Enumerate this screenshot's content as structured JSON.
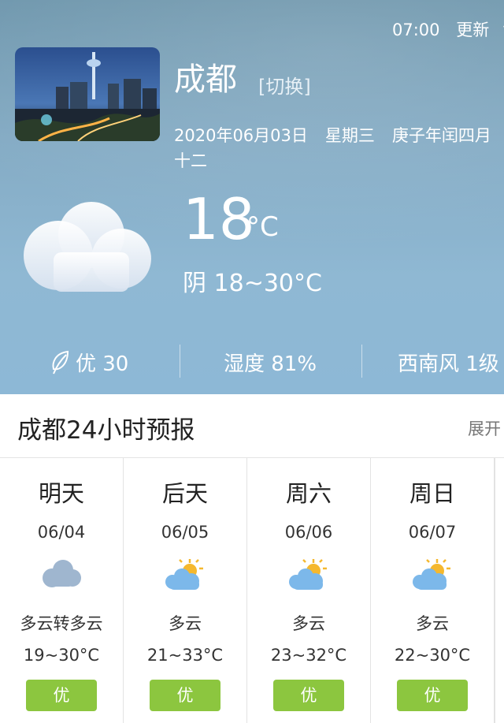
{
  "status": {
    "time": "07:00",
    "refresh_label": "更新",
    "refresh_icon": "refresh-icon"
  },
  "location": {
    "city": "成都",
    "switch_label": "[切换]"
  },
  "date": {
    "date_text": "2020年06月03日",
    "weekday": "星期三",
    "lunar": "庚子年闰四月十二"
  },
  "current": {
    "temperature": "18",
    "unit": "°C",
    "condition": "阴 18~30°C",
    "icon": "cloudy-icon"
  },
  "metrics": {
    "air_quality": "优 30",
    "humidity": "湿度 81%",
    "wind": "西南风 1级"
  },
  "forecast": {
    "title": "成都24小时预报",
    "expand_label": "展开",
    "days": [
      {
        "day": "明天",
        "date": "06/04",
        "condition": "多云转多云",
        "temp": "19~30°C",
        "aqi": "优",
        "icon": "cloud-icon"
      },
      {
        "day": "后天",
        "date": "06/05",
        "condition": "多云",
        "temp": "21~33°C",
        "aqi": "优",
        "icon": "partly-cloudy-icon"
      },
      {
        "day": "周六",
        "date": "06/06",
        "condition": "多云",
        "temp": "23~32°C",
        "aqi": "优",
        "icon": "partly-cloudy-icon"
      },
      {
        "day": "周日",
        "date": "06/07",
        "condition": "多云",
        "temp": "22~30°C",
        "aqi": "优",
        "icon": "partly-cloudy-icon"
      }
    ]
  },
  "colors": {
    "sky_top": "#6f97ad",
    "sky_bottom": "#8db8d6",
    "aqi_green": "#8cc63f"
  }
}
